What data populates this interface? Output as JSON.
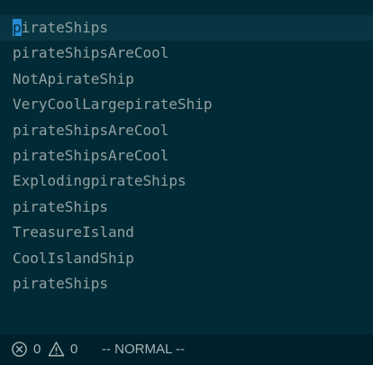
{
  "editor": {
    "lines": [
      {
        "before": "",
        "cursor_char": "p",
        "after": "irateShips"
      },
      {
        "text": "pirateShipsAreCool"
      },
      {
        "text": "NotApirateShip"
      },
      {
        "text": "VeryCoolLargepirateShip"
      },
      {
        "text": "pirateShipsAreCool"
      },
      {
        "text": "pirateShipsAreCool"
      },
      {
        "text": "ExplodingpirateShips"
      },
      {
        "text": "pirateShips"
      },
      {
        "text": "TreasureIsland"
      },
      {
        "text": "CoolIslandShip"
      },
      {
        "text": "pirateShips"
      }
    ]
  },
  "status": {
    "errors": {
      "icon": "error-circle-icon",
      "count": "0"
    },
    "warnings": {
      "icon": "warning-triangle-icon",
      "count": "0"
    },
    "mode": "-- NORMAL --"
  },
  "colors": {
    "background": "#002b36",
    "current_line": "#073642",
    "text": "#93a1a1",
    "cursor": "#268bd2",
    "statusbar": "#00212b"
  }
}
